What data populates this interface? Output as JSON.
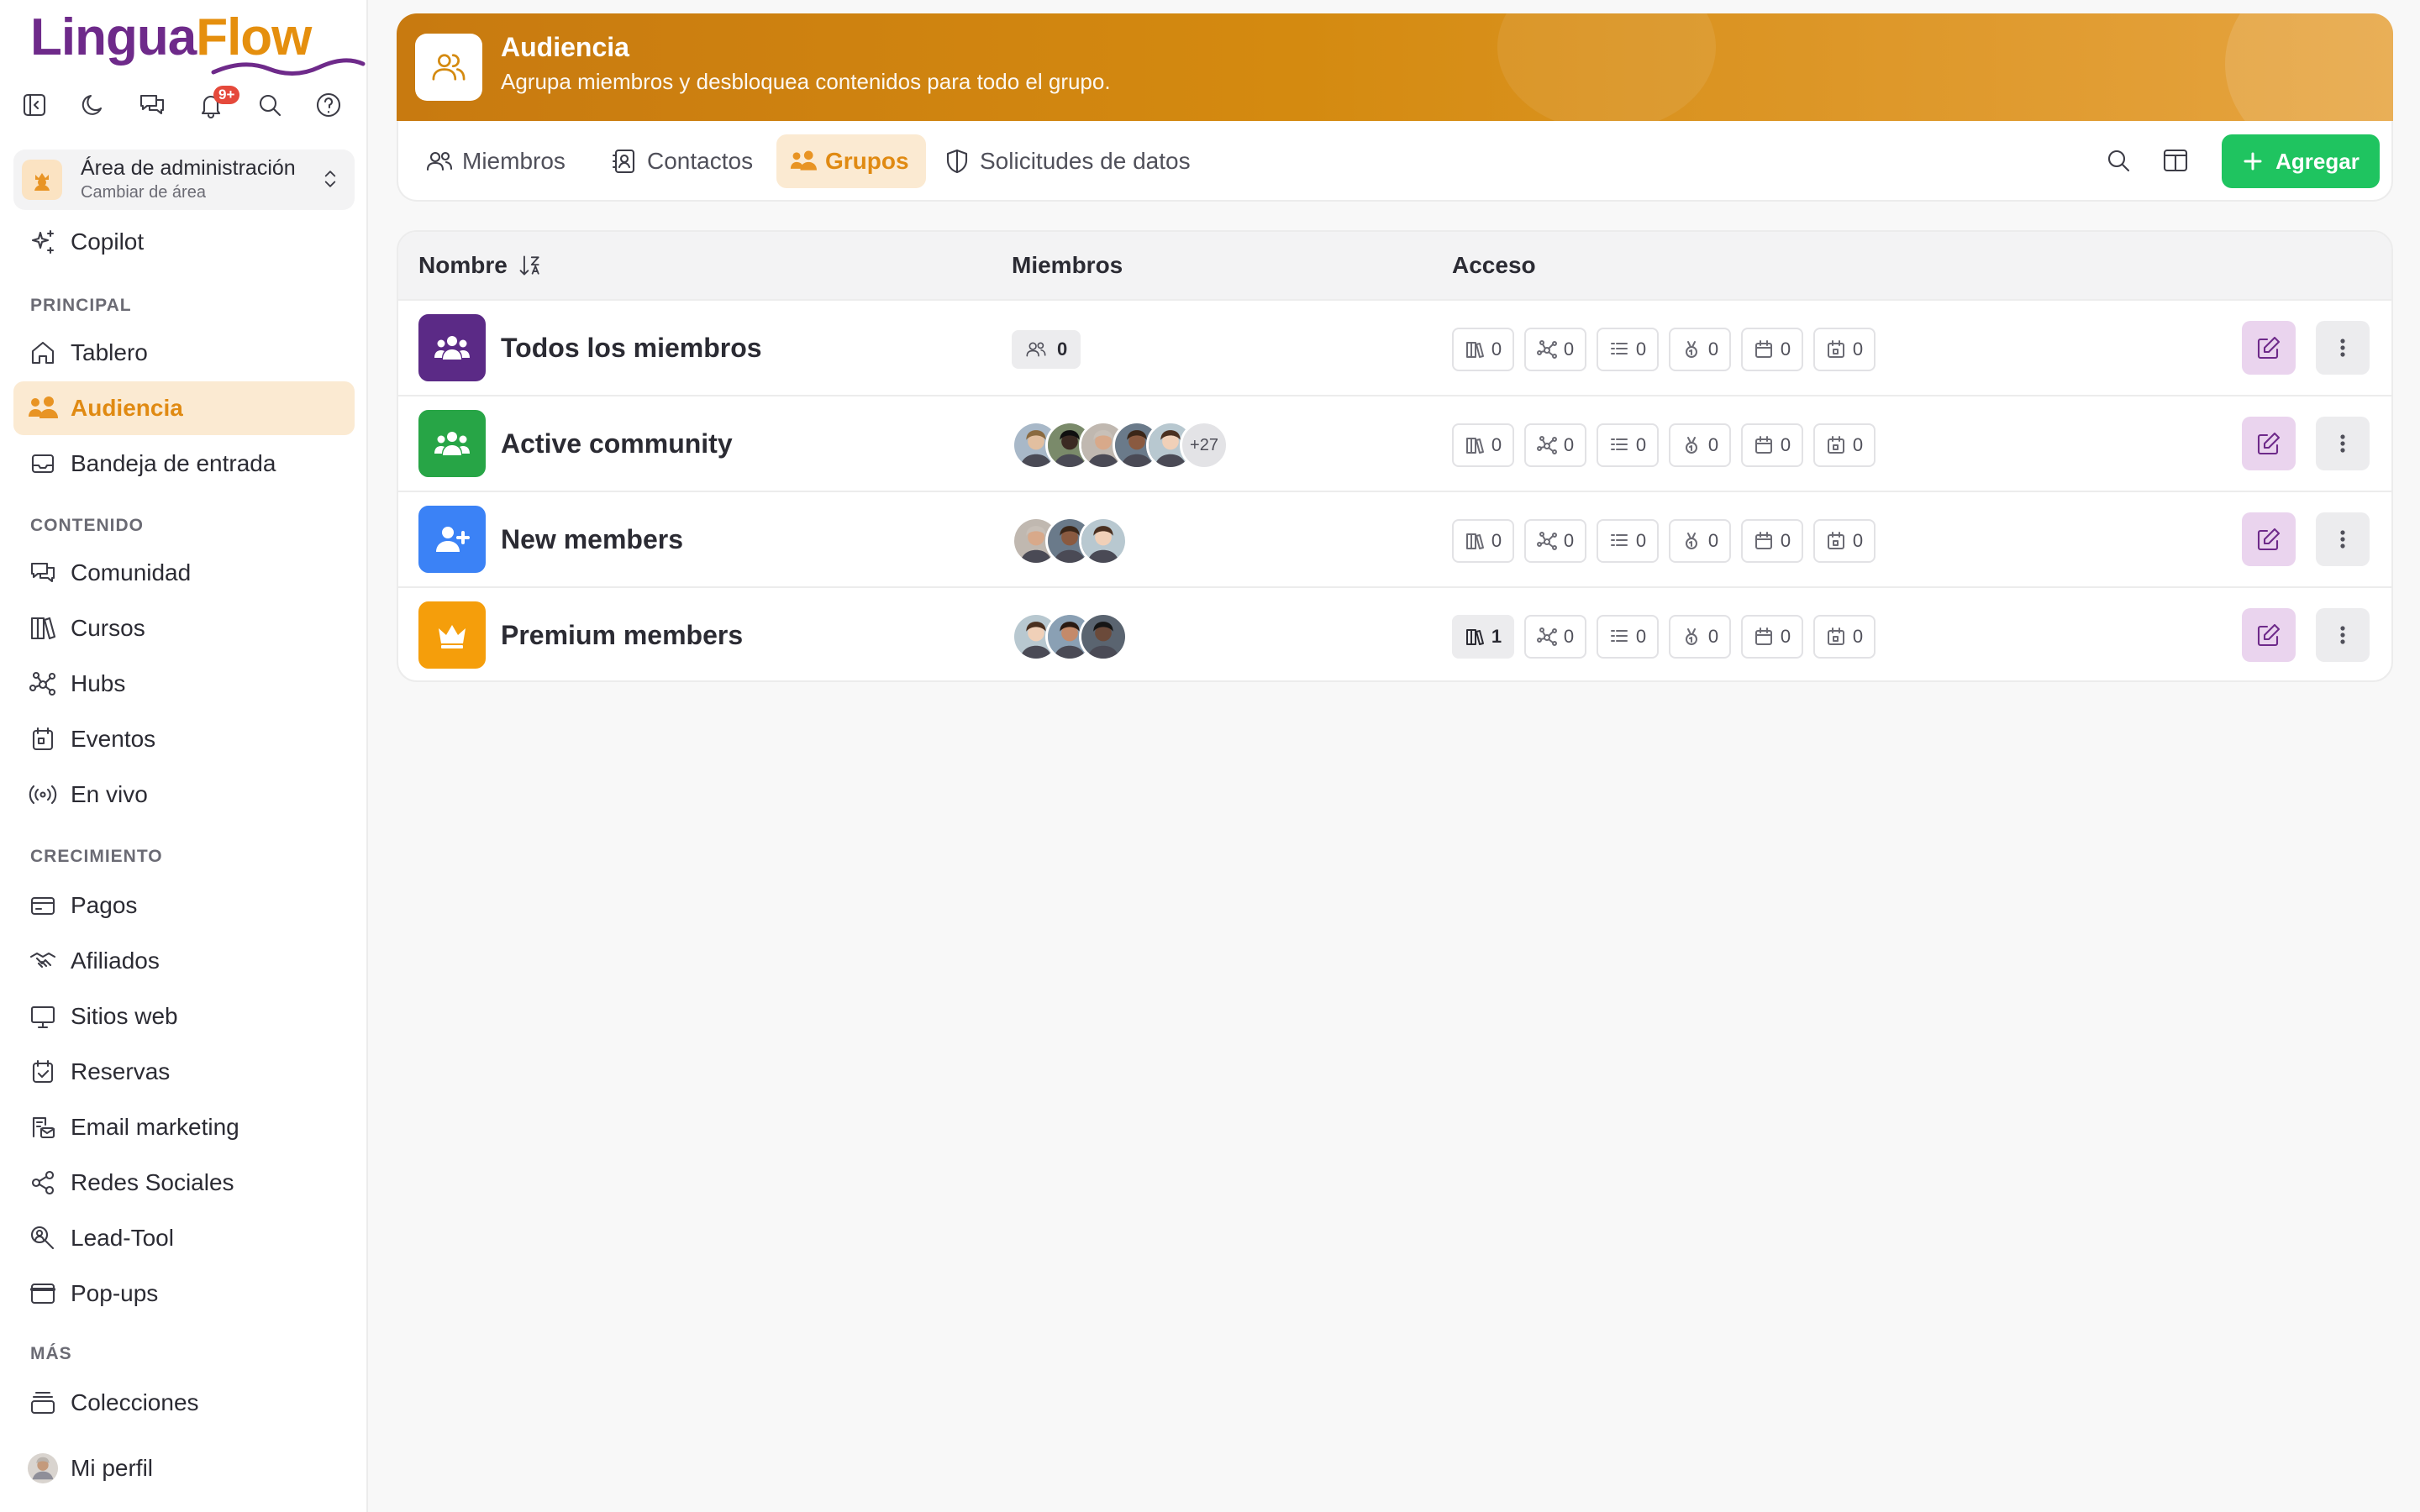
{
  "app": {
    "name_part1": "Lingua",
    "name_part2": "Flow",
    "notif_badge": "9+"
  },
  "area": {
    "title": "Área de administración",
    "subtitle": "Cambiar de área"
  },
  "sidebar": {
    "copilot": "Copilot",
    "sections": {
      "principal": "PRINCIPAL",
      "contenido": "CONTENIDO",
      "crecimiento": "CRECIMIENTO",
      "mas": "MÁS"
    },
    "items": {
      "tablero": "Tablero",
      "audiencia": "Audiencia",
      "bandeja": "Bandeja de entrada",
      "comunidad": "Comunidad",
      "cursos": "Cursos",
      "hubs": "Hubs",
      "eventos": "Eventos",
      "envivo": "En vivo",
      "pagos": "Pagos",
      "afiliados": "Afiliados",
      "sitios": "Sitios web",
      "reservas": "Reservas",
      "email": "Email marketing",
      "redes": "Redes Sociales",
      "lead": "Lead-Tool",
      "popups": "Pop-ups",
      "colecciones": "Colecciones",
      "perfil": "Mi perfil"
    }
  },
  "header": {
    "title": "Audiencia",
    "subtitle": "Agrupa miembros y desbloquea contenidos para todo el grupo."
  },
  "tabs": {
    "miembros": "Miembros",
    "contactos": "Contactos",
    "grupos": "Grupos",
    "solicitudes": "Solicitudes de datos"
  },
  "add_button": "Agregar",
  "table": {
    "columns": {
      "nombre": "Nombre",
      "miembros": "Miembros",
      "acceso": "Acceso"
    },
    "rows": [
      {
        "name": "Todos los miembros",
        "color": "#5b2a86",
        "member_count": "0",
        "extra": "",
        "access": [
          "0",
          "0",
          "0",
          "0",
          "0",
          "0"
        ]
      },
      {
        "name": "Active community",
        "color": "#27a546",
        "member_count": "",
        "extra": "+27",
        "access": [
          "0",
          "0",
          "0",
          "0",
          "0",
          "0"
        ]
      },
      {
        "name": "New members",
        "color": "#3b82f6",
        "member_count": "",
        "extra": "",
        "access": [
          "0",
          "0",
          "0",
          "0",
          "0",
          "0"
        ]
      },
      {
        "name": "Premium members",
        "color": "#f59e0b",
        "member_count": "",
        "extra": "",
        "access": [
          "1",
          "0",
          "0",
          "0",
          "0",
          "0"
        ]
      }
    ]
  },
  "colors": {
    "accent": "#e58f0e",
    "accent_bg": "#fbead2",
    "brand_purple": "#6e2a8a",
    "green": "#1fc460"
  }
}
